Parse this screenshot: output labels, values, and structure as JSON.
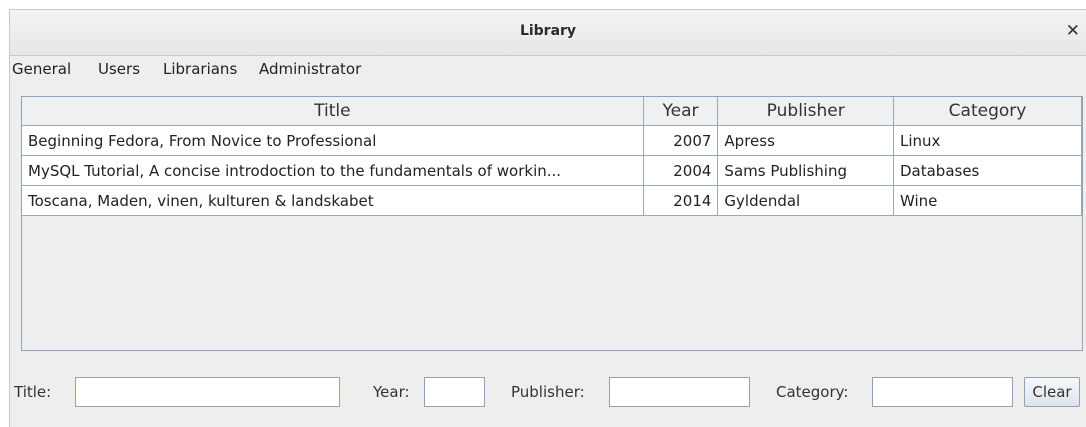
{
  "window": {
    "title": "Library"
  },
  "menu": [
    "General",
    "Users",
    "Librarians",
    "Administrator"
  ],
  "table": {
    "columns": [
      "Title",
      "Year",
      "Publisher",
      "Category"
    ],
    "rows": [
      [
        "Beginning Fedora, From Novice to Professional",
        "2007",
        "Apress",
        "Linux"
      ],
      [
        "MySQL Tutorial, A concise introdoction to the fundamentals of workin...",
        "2004",
        "Sams Publishing",
        "Databases"
      ],
      [
        "Toscana, Maden, vinen, kulturen & landskabet",
        "2014",
        "Gyldendal",
        "Wine"
      ]
    ]
  },
  "form": {
    "title_label": "Title:",
    "year_label": "Year:",
    "publisher_label": "Publisher:",
    "category_label": "Category:",
    "title_value": "",
    "year_value": "",
    "publisher_value": "",
    "category_value": "",
    "clear_label": "Clear"
  }
}
